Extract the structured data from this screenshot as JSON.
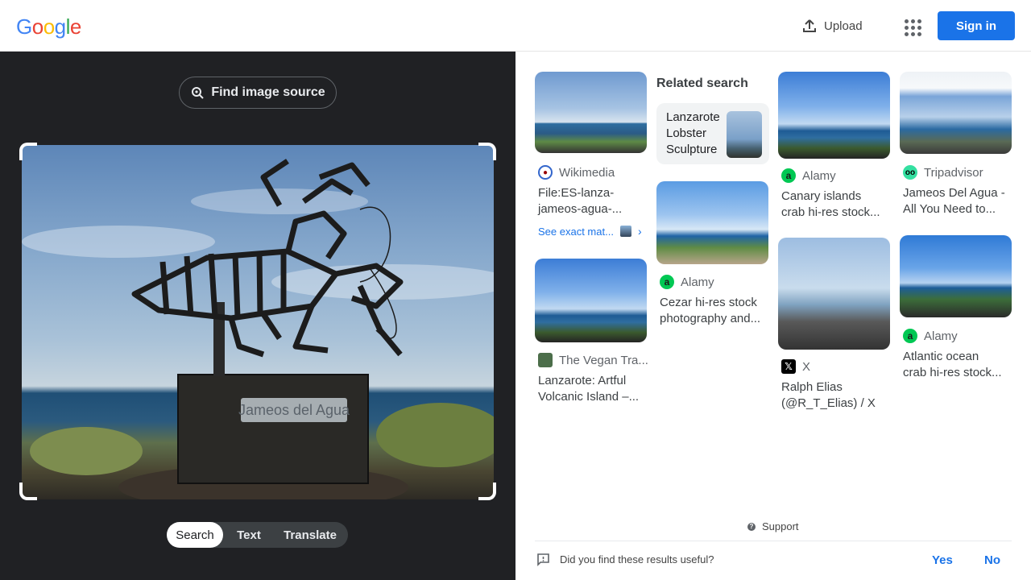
{
  "header": {
    "logo_letters": [
      {
        "ch": "G",
        "color": "#4285F4"
      },
      {
        "ch": "o",
        "color": "#EA4335"
      },
      {
        "ch": "o",
        "color": "#FBBC05"
      },
      {
        "ch": "g",
        "color": "#4285F4"
      },
      {
        "ch": "l",
        "color": "#34A853"
      },
      {
        "ch": "e",
        "color": "#EA4335"
      }
    ],
    "upload_label": "Upload",
    "signin_label": "Sign in"
  },
  "left": {
    "find_source_label": "Find image source",
    "modes": [
      "Search",
      "Text",
      "Translate"
    ],
    "active_mode": "Search",
    "sign_text": "Jameos del Agua"
  },
  "results": {
    "related_heading": "Related search",
    "related_query_lines": [
      "Lanzarote",
      "Lobster",
      "Sculpture"
    ],
    "cards": [
      {
        "source": "Wikimedia",
        "title_lines": [
          "File:ES-lanza-",
          "jameos-agua-..."
        ],
        "favicon": "wikimedia",
        "exact_label": "See exact mat..."
      },
      {
        "source": "The Vegan Tra...",
        "title_lines": [
          "Lanzarote: Artful",
          "Volcanic Island –..."
        ],
        "favicon": "vegan"
      },
      {
        "source": "Alamy",
        "title_lines": [
          "Cezar hi-res stock",
          "photography and..."
        ],
        "favicon": "alamy"
      },
      {
        "source": "Alamy",
        "title_lines": [
          "Canary islands",
          "crab hi-res stock..."
        ],
        "favicon": "alamy"
      },
      {
        "source": "X",
        "title_lines": [
          "Ralph Elias",
          "(@R_T_Elias) / X"
        ],
        "favicon": "x"
      },
      {
        "source": "Tripadvisor",
        "title_lines": [
          "Jameos Del Agua -",
          "All You Need to..."
        ],
        "favicon": "tripadvisor"
      },
      {
        "source": "Alamy",
        "title_lines": [
          "Atlantic ocean",
          "crab hi-res stock..."
        ],
        "favicon": "alamy"
      }
    ],
    "support_label": "Support",
    "feedback_question": "Did you find these results useful?",
    "yes_label": "Yes",
    "no_label": "No"
  },
  "colors": {
    "accent": "#1a73e8",
    "dark_pane": "#202124",
    "alamy_green": "#00c853",
    "tripadvisor_green": "#34e0a1"
  }
}
